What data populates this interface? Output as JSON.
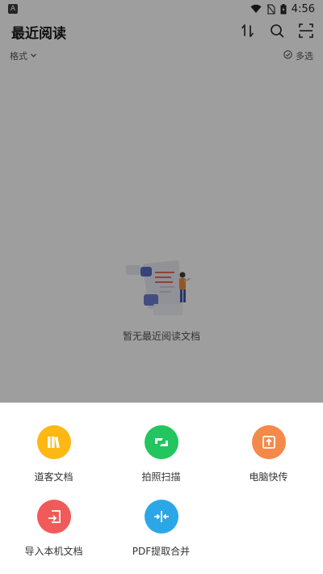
{
  "status_bar": {
    "badge": "A",
    "time": "4:56"
  },
  "app_bar": {
    "title": "最近阅读"
  },
  "filter_bar": {
    "format_label": "格式",
    "multiselect_label": "多选"
  },
  "empty_state": {
    "message": "暂无最近阅读文档"
  },
  "sheet": {
    "actions": [
      {
        "label": "道客文档",
        "color": "#FDB813",
        "icon": "books-icon"
      },
      {
        "label": "拍照扫描",
        "color": "#22C55E",
        "icon": "scan-icon"
      },
      {
        "label": "电脑快传",
        "color": "#F5894A",
        "icon": "upload-icon"
      },
      {
        "label": "导入本机文档",
        "color": "#F25A5A",
        "icon": "import-icon"
      },
      {
        "label": "PDF提取合并",
        "color": "#2BA7E8",
        "icon": "merge-icon"
      }
    ]
  }
}
